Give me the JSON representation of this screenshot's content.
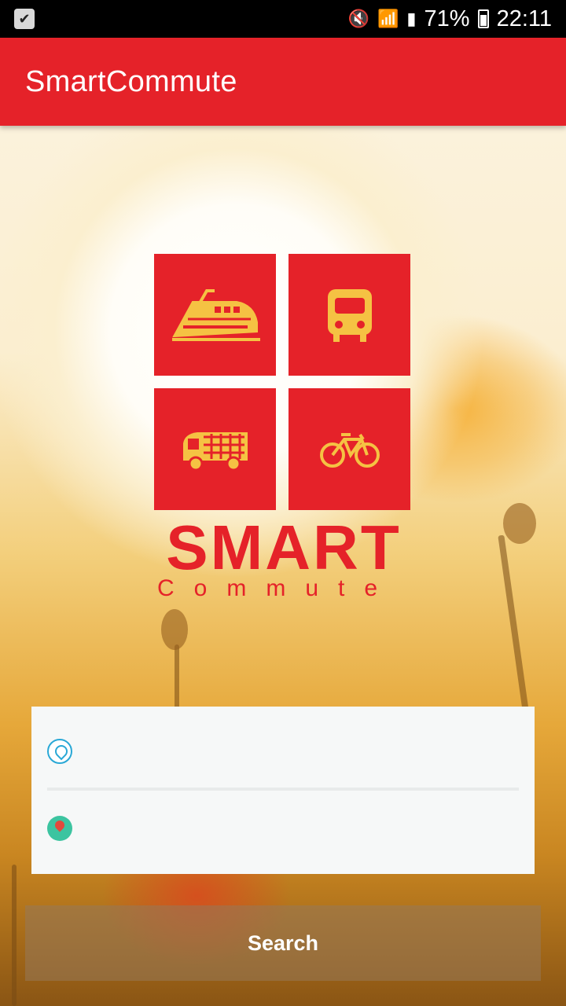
{
  "status_bar": {
    "battery_percent": "71%",
    "time": "22:11",
    "icons": [
      "notification-check-icon",
      "mute-icon",
      "wifi-icon",
      "signal-icon",
      "battery-icon"
    ]
  },
  "app_bar": {
    "title": "SmartCommute",
    "color": "#e52229"
  },
  "logo": {
    "line1": "SMART",
    "line2": "Commute",
    "tiles": [
      "train-icon",
      "bus-icon",
      "tram-icon",
      "bicycle-icon"
    ]
  },
  "form": {
    "origin": {
      "value": "",
      "icon": "origin-location-icon"
    },
    "destination": {
      "value": "",
      "icon": "destination-pin-icon"
    }
  },
  "search_button": {
    "label": "Search"
  }
}
